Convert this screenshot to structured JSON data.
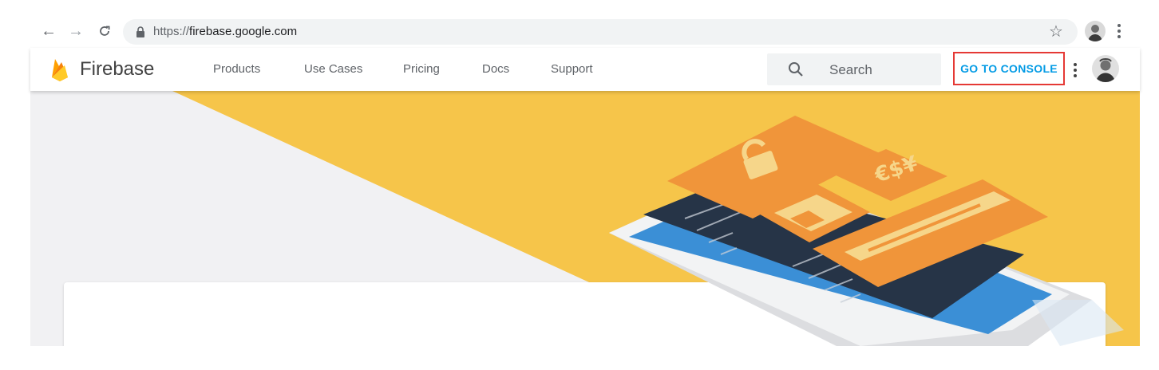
{
  "browser": {
    "back_icon": "arrow-left-icon",
    "forward_icon": "arrow-right-icon",
    "reload_icon": "reload-icon",
    "url_scheme": "https://",
    "url_host": "firebase.google.com",
    "bookmark_icon": "star-icon",
    "menu_icon": "vertical-dots-icon"
  },
  "header": {
    "brand": "Firebase",
    "nav": [
      "Products",
      "Use Cases",
      "Pricing",
      "Docs",
      "Support"
    ],
    "search_placeholder": "Search",
    "console_button": "GO TO CONSOLE"
  },
  "colors": {
    "accent_yellow": "#F6C54A",
    "accent_orange": "#F0953A",
    "console_blue": "#039BE5",
    "highlight_red": "#E53935"
  }
}
